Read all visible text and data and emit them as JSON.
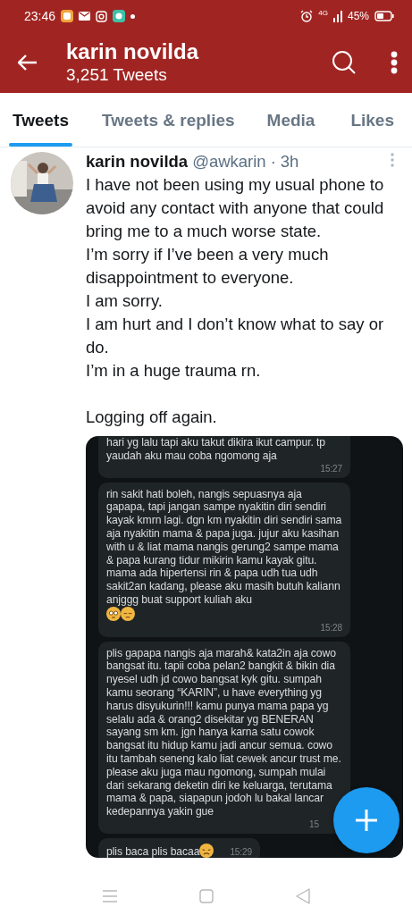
{
  "status_bar": {
    "time": "23:46",
    "network": "4G",
    "battery": "45%"
  },
  "header": {
    "title": "karin novilda",
    "subtitle": "3,251 Tweets"
  },
  "tabs": [
    {
      "label": "Tweets",
      "selected": true
    },
    {
      "label": "Tweets & replies",
      "selected": false
    },
    {
      "label": "Media",
      "selected": false
    },
    {
      "label": "Likes",
      "selected": false
    }
  ],
  "tweet": {
    "name": "karin novilda",
    "handle": "@awkarin",
    "separator": "·",
    "time": "3h",
    "paragraphs": [
      "I have not been using my usual phone to avoid any contact with anyone that could bring me to a much worse state.",
      "I’m sorry if I’ve been a very much disappointment to everyone.",
      "I am sorry.",
      "I am hurt and I don’t know what to say or do.",
      "I’m in a huge trauma rn."
    ],
    "signoff": "Logging off again.",
    "image": {
      "messages": [
        {
          "text": "hari yg lalu tapi aku takut dikira ikut campur. tp yaudah aku mau coba ngomong aja",
          "time": "15:27"
        },
        {
          "text": "rin sakit hati boleh, nangis sepuasnya aja gapapa, tapi jangan sampe nyakitin diri sendiri kayak kmrn lagi. dgn km nyakitin diri sendiri sama aja nyakitin mama & papa juga. jujur aku kasihan with u & liat mama nangis gerung2 sampe mama & papa kurang tidur mikirin kamu kayak gitu. mama ada hipertensi rin & papa udh tua udh sakit2an kadang, please aku masih butuh kaliann anjggg buat support kuliah aku",
          "time": "15:28",
          "emojis": [
            {
              "kind": "flushed"
            },
            {
              "kind": "pensive"
            }
          ]
        },
        {
          "text": "plis gapapa nangis aja marah& kata2in aja cowo bangsat itu. tapii coba pelan2 bangkit & bikin dia nyesel udh jd cowo bangsat kyk gitu. sumpah kamu seorang “KARIN”, u have everything yg harus disyukurin!!! kamu punya mama papa yg selalu ada & orang2 disekitar yg BENERAN sayang sm km. jgn hanya karna satu cowok bangsat itu hidup kamu jadi ancur semua. cowo itu tambah seneng kalo liat cewek ancur trust me. please aku juga mau ngomong, sumpah mulai dari sekarang deketin diri ke keluarga, terutama mama & papa, siapapun jodoh lu bakal lancar kedepannya yakin gue",
          "time": "15"
        },
        {
          "text": "plis baca plis bacaa",
          "time": "15:29",
          "emojis": [
            {
              "kind": "frowning"
            }
          ]
        }
      ]
    }
  }
}
